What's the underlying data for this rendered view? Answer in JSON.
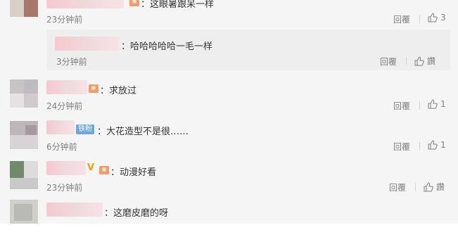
{
  "comments": [
    {
      "text": "：这眼暑跟呆一样",
      "time": "23分钟前",
      "reply_label": "回覆",
      "like_count": "3"
    },
    {
      "reply": {
        "text": "：哈哈哈哈哈一毛一样",
        "time": "3分钟前",
        "reply_label": "回覆",
        "like_label": "讚"
      }
    },
    {
      "text": "：求放过",
      "time": "24分钟前",
      "reply_label": "回覆",
      "like_count": "1"
    },
    {
      "badge": "铁粉",
      "text": "：大花造型不是很……",
      "time": "6分钟前",
      "reply_label": "回覆",
      "like_count": "1"
    },
    {
      "v_mark": "V",
      "text": "：动漫好看",
      "time": "23分钟前",
      "reply_label": "回覆",
      "like_label": "讚"
    },
    {
      "text": "：这磨皮磨的呀"
    }
  ],
  "colors": {
    "strip_bg": "#f5f5f5",
    "reply_bg": "#eeeeee",
    "time": "#808080",
    "badge": "#6da6e3",
    "v_mark": "#f0a000"
  },
  "icons": [
    "thumbs-up-icon",
    "fan-level-icon"
  ]
}
